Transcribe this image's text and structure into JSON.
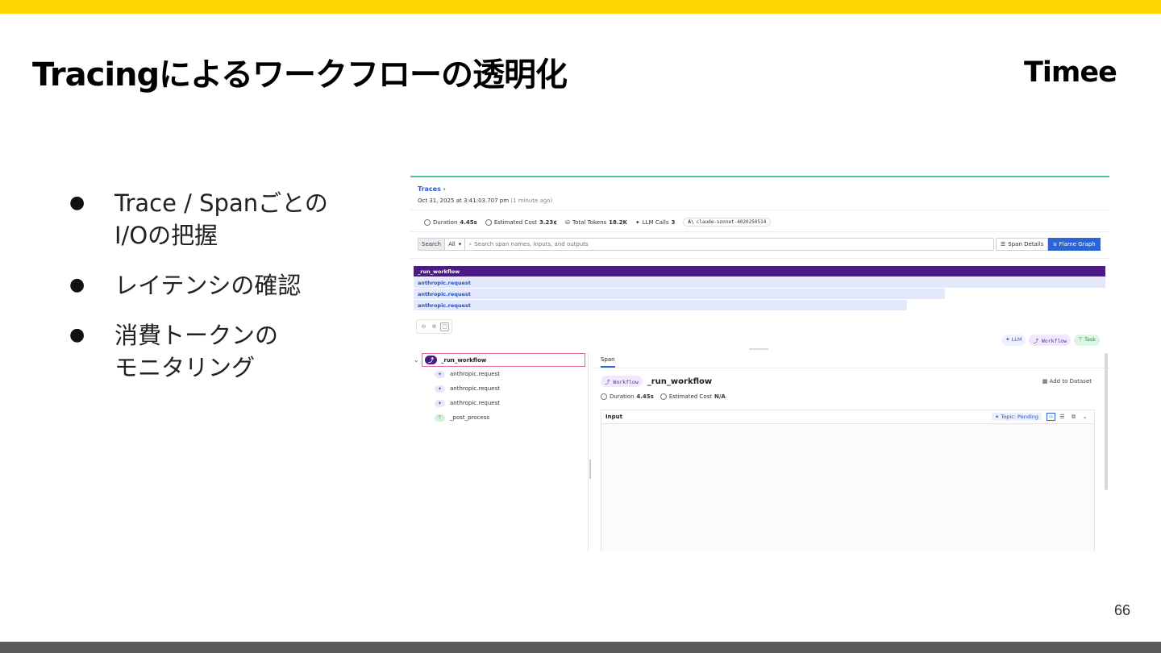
{
  "slide": {
    "title": "Tracingによるワークフローの透明化",
    "brand": "Timee",
    "page_number": "66",
    "bullets": [
      "Trace / Spanごとの\nI/Oの把握",
      "レイテンシの確認",
      "消費トークンの\nモニタリング"
    ]
  },
  "trace": {
    "breadcrumb": "Traces",
    "date": "Oct 31, 2025 at 3:41:03.707 pm",
    "date_relative": "(1 minute ago)",
    "metrics": {
      "duration_label": "Duration",
      "duration_value": "4.45s",
      "cost_label": "Estimated Cost",
      "cost_value": "3.23¢",
      "tokens_label": "Total Tokens",
      "tokens_value": "18.2K",
      "llm_label": "LLM Calls",
      "llm_value": "3",
      "model": "claude-sonnet-4020250514"
    },
    "search": {
      "label": "Search",
      "scope": "All",
      "placeholder": "Search span names, inputs, and outputs"
    },
    "views": {
      "span_details": "Span Details",
      "flame_graph": "Flame Graph"
    },
    "flame": [
      {
        "label": "_run_workflow",
        "fraction": 1.0
      },
      {
        "label": "anthropic.request",
        "fraction": 1.0
      },
      {
        "label": "anthropic.request",
        "fraction": 0.768
      },
      {
        "label": "anthropic.request",
        "fraction": 0.713
      }
    ],
    "legend": {
      "llm": "LLM",
      "workflow": "Workflow",
      "task": "Task"
    },
    "tree": {
      "root": "_run_workflow",
      "children": [
        {
          "label": "anthropic.request",
          "kind": "llm"
        },
        {
          "label": "anthropic.request",
          "kind": "llm"
        },
        {
          "label": "anthropic.request",
          "kind": "llm"
        },
        {
          "label": "_post_process",
          "kind": "task"
        }
      ]
    },
    "detail": {
      "tab": "Span",
      "type_pill": "Workflow",
      "name": "_run_workflow",
      "add_dataset": "Add to Dataset",
      "duration_label": "Duration",
      "duration_value": "4.45s",
      "cost_label": "Estimated Cost",
      "cost_value": "N/A",
      "input_label": "Input",
      "topic": "Topic: Pending"
    }
  }
}
